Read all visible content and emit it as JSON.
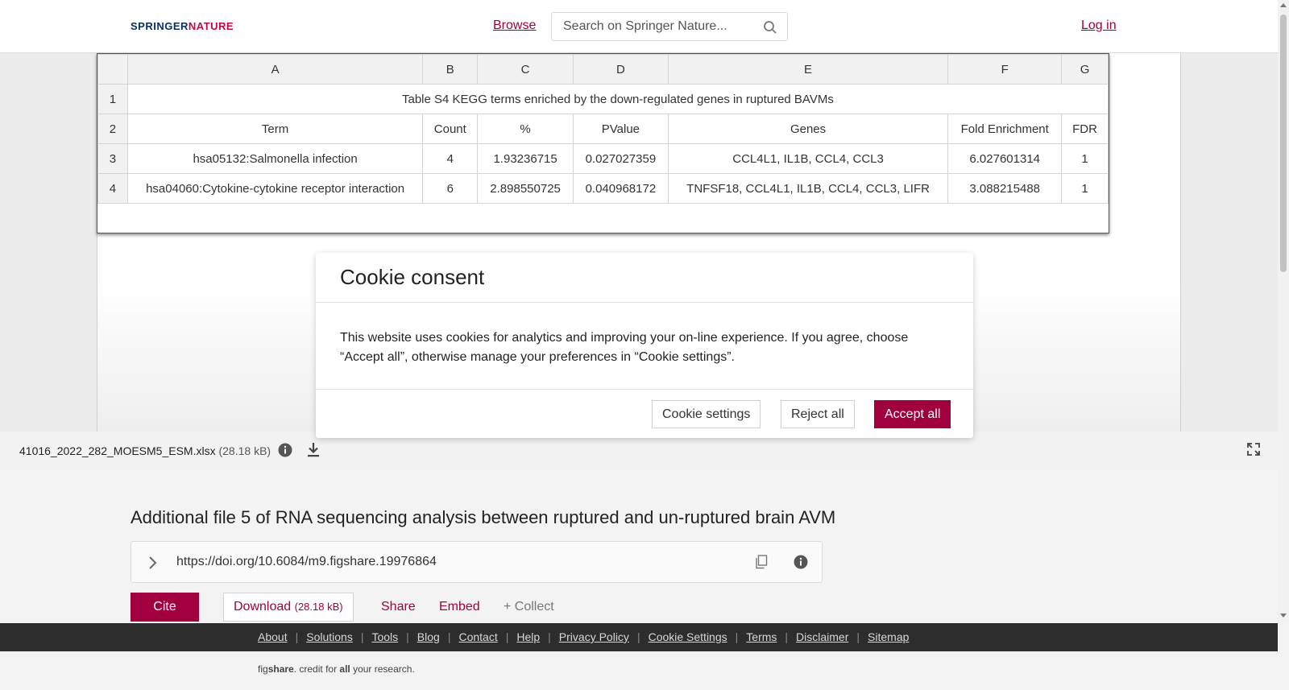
{
  "header": {
    "logo_part1": "SPRINGER",
    "logo_part2": "NATURE",
    "browse_label": "Browse",
    "search_placeholder": "Search on Springer Nature...",
    "login_label": "Log in"
  },
  "spreadsheet": {
    "column_headers": [
      "",
      "A",
      "B",
      "C",
      "D",
      "E",
      "F",
      "G"
    ],
    "title_row": {
      "row_num": "1",
      "text": "Table S4 KEGG terms enriched by the down-regulated genes in ruptured BAVMs"
    },
    "header_row": {
      "row_num": "2",
      "cells": [
        "Term",
        "Count",
        "%",
        "PValue",
        "Genes",
        "Fold Enrichment",
        "FDR"
      ]
    },
    "data_rows": [
      {
        "row_num": "3",
        "cells": [
          "hsa05132:Salmonella infection",
          "4",
          "1.93236715",
          "0.027027359",
          "CCL4L1, IL1B, CCL4, CCL3",
          "6.027601314",
          "1"
        ]
      },
      {
        "row_num": "4",
        "cells": [
          "hsa04060:Cytokine-cytokine receptor interaction",
          "6",
          "2.898550725",
          "0.040968172",
          "TNFSF18, CCL4L1, IL1B, CCL4, CCL3, LIFR",
          "3.088215488",
          "1"
        ]
      }
    ]
  },
  "file_bar": {
    "file_name": "41016_2022_282_MOESM5_ESM.xlsx",
    "file_size": "(28.18 kB)"
  },
  "item": {
    "title": "Additional file 5 of RNA sequencing analysis between ruptured and un-ruptured brain AVM",
    "doi": "https://doi.org/10.6084/m9.figshare.19976864"
  },
  "actions": {
    "cite_label": "Cite",
    "download_label": "Download",
    "download_size": "(28.18 kB)",
    "share_label": "Share",
    "embed_label": "Embed",
    "collect_label": "+ Collect"
  },
  "footer": {
    "links": [
      "About",
      "Solutions",
      "Tools",
      "Blog",
      "Contact",
      "Help",
      "Privacy Policy",
      "Cookie Settings",
      "Terms",
      "Disclaimer",
      "Sitemap"
    ],
    "tagline_fig": "fig",
    "tagline_share": "share",
    "tagline_mid": ". credit for ",
    "tagline_all": "all",
    "tagline_end": " your research."
  },
  "cookie_modal": {
    "title": "Cookie consent",
    "body": "This website uses cookies for analytics and improving your on-line experience. If you agree, choose “Accept all”, otherwise manage your preferences in “Cookie settings”.",
    "settings_label": "Cookie settings",
    "reject_label": "Reject all",
    "accept_label": "Accept all"
  },
  "colors": {
    "brand": "#a1003e",
    "logo_navy": "#0b2f64",
    "footer_bg": "#2d2d2d"
  }
}
